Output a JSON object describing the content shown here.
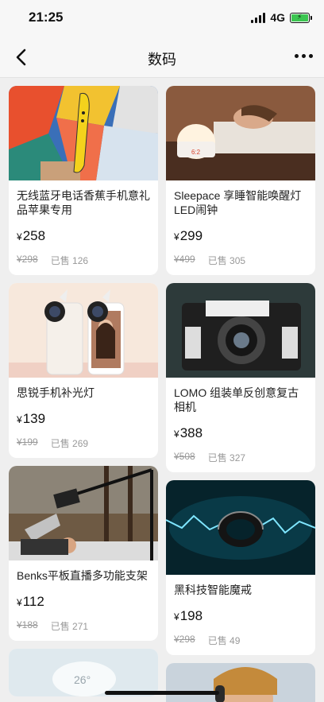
{
  "status": {
    "time": "21:25",
    "network": "4G"
  },
  "nav": {
    "title": "数码"
  },
  "products_left": [
    {
      "title": "无线蓝牙电话香蕉手机意礼品苹果专用",
      "price": "258",
      "old_price": "¥298",
      "sold": "已售 126"
    },
    {
      "title": "思锐手机补光灯",
      "price": "139",
      "old_price": "¥199",
      "sold": "已售 269"
    },
    {
      "title": "Benks平板直播多功能支架",
      "price": "112",
      "old_price": "¥188",
      "sold": "已售 271"
    }
  ],
  "products_right": [
    {
      "title": "Sleepace 享睡智能唤醒灯 LED闹钟",
      "price": "299",
      "old_price": "¥499",
      "sold": "已售 305"
    },
    {
      "title": "LOMO 组装单反创意复古相机",
      "price": "388",
      "old_price": "¥508",
      "sold": "已售 327"
    },
    {
      "title": "黑科技智能魔戒",
      "price": "198",
      "old_price": "¥298",
      "sold": "已售 49"
    }
  ],
  "currency": "¥",
  "partial_image_text": "26°",
  "colors": {
    "background": "#efefef",
    "card": "#ffffff",
    "muted": "#999999"
  }
}
